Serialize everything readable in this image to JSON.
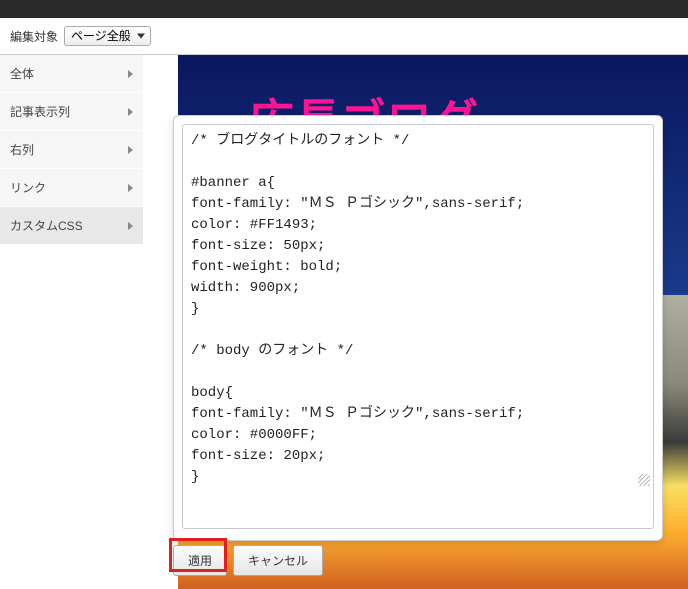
{
  "toolbar": {
    "label": "編集対象",
    "selected": "ページ全般"
  },
  "sidebar": {
    "items": [
      {
        "label": "全体"
      },
      {
        "label": "記事表示列"
      },
      {
        "label": "右列"
      },
      {
        "label": "リンク"
      },
      {
        "label": "カスタムCSS"
      }
    ]
  },
  "bg": {
    "title": "広長ゴログ"
  },
  "editor": {
    "content": "/* ブログタイトルのフォント */\n\n#banner a{\nfont-family: \"ＭＳ Ｐゴシック\",sans-serif;\ncolor: #FF1493;\nfont-size: 50px;\nfont-weight: bold;\nwidth: 900px;\n}\n\n/* body のフォント */\n\nbody{\nfont-family: \"ＭＳ Ｐゴシック\",sans-serif;\ncolor: #0000FF;\nfont-size: 20px;\n}"
  },
  "buttons": {
    "apply": "適用",
    "cancel": "キャンセル"
  }
}
